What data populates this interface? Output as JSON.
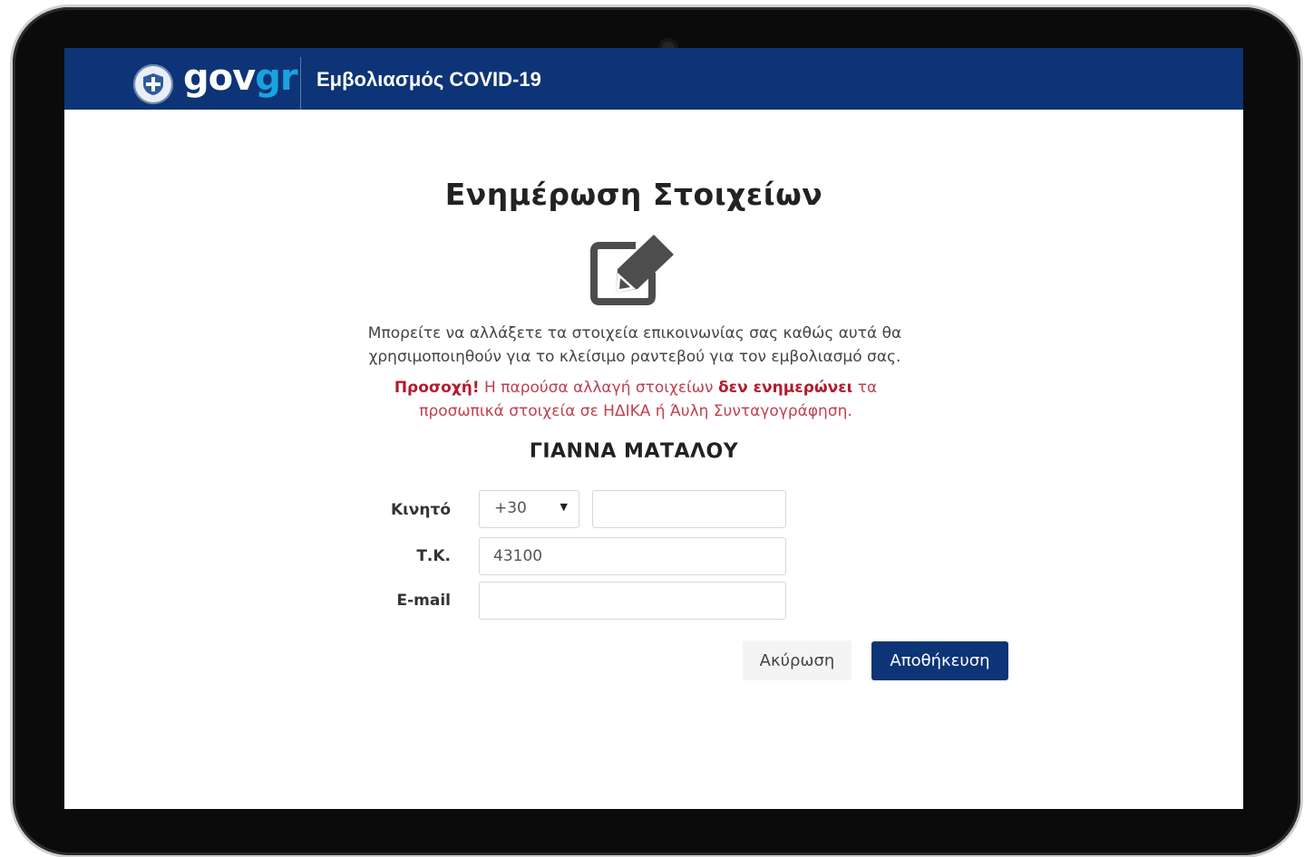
{
  "header": {
    "logo_gov": "gov",
    "logo_gr": "gr",
    "app_title": "Εμβολιασμός COVID-19"
  },
  "page": {
    "title": "Ενημέρωση Στοιχείων",
    "icon": "edit-icon",
    "description": "Μπορείτε να αλλάξετε τα στοιχεία επικοινωνίας σας καθώς αυτά θα χρησιμοποιηθούν για το κλείσιμο ραντεβού για τον εμβολιασμό σας.",
    "warning": {
      "lead": "Προσοχή!",
      "text_1": " Η παρούσα αλλαγή στοιχείων ",
      "emphasis": "δεν ενημερώνει",
      "text_2": " τα προσωπικά στοιχεία σε ΗΔΙΚΑ ή Άυλη Συνταγογράφηση."
    },
    "person_name": "ΓΙΑΝΝΑ ΜΑΤΑΛΟΥ"
  },
  "form": {
    "mobile": {
      "label": "Κινητό",
      "country_code": "+30",
      "value": ""
    },
    "postal_code": {
      "label": "Τ.Κ.",
      "value": "43100"
    },
    "email": {
      "label": "E-mail",
      "value": ""
    }
  },
  "actions": {
    "cancel_label": "Ακύρωση",
    "save_label": "Αποθήκευση"
  },
  "colors": {
    "header_bg": "#0d3476",
    "logo_accent": "#19a3e0",
    "warning": "#b11d2f",
    "primary_button": "#0d3476"
  }
}
